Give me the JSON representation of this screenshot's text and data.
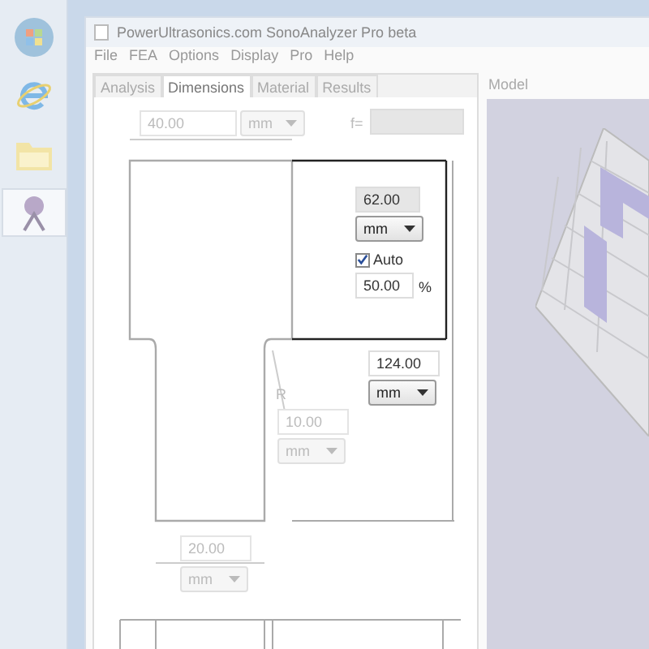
{
  "taskbar": {
    "items": [
      {
        "selected": false
      },
      {
        "selected": false
      },
      {
        "selected": false
      },
      {
        "selected": true
      }
    ]
  },
  "window": {
    "title": "PowerUltrasonics.com SonoAnalyzer Pro beta"
  },
  "menu": [
    "File",
    "FEA",
    "Options",
    "Display",
    "Pro",
    "Help"
  ],
  "tabs": [
    {
      "label": "Analysis",
      "selected": false
    },
    {
      "label": "Dimensions",
      "selected": true
    },
    {
      "label": "Material",
      "selected": false
    },
    {
      "label": "Results",
      "selected": false
    }
  ],
  "dimensions": {
    "top_width": {
      "value": "40.00",
      "unit": "mm",
      "disabled": true
    },
    "frequency": {
      "label": "f="
    },
    "top_length": {
      "value": "62.00",
      "unit": "mm",
      "disabled": false
    },
    "auto": {
      "label": "Auto",
      "checked": true
    },
    "auto_percent": {
      "value": "50.00",
      "unit": "%"
    },
    "total_length": {
      "value": "124.00",
      "unit": "mm",
      "disabled": false
    },
    "radius": {
      "label": "R",
      "value": "10.00",
      "unit": "mm",
      "disabled": true
    },
    "bottom_width": {
      "value": "20.00",
      "unit": "mm",
      "disabled": true
    }
  },
  "model_panel": {
    "title": "Model"
  }
}
